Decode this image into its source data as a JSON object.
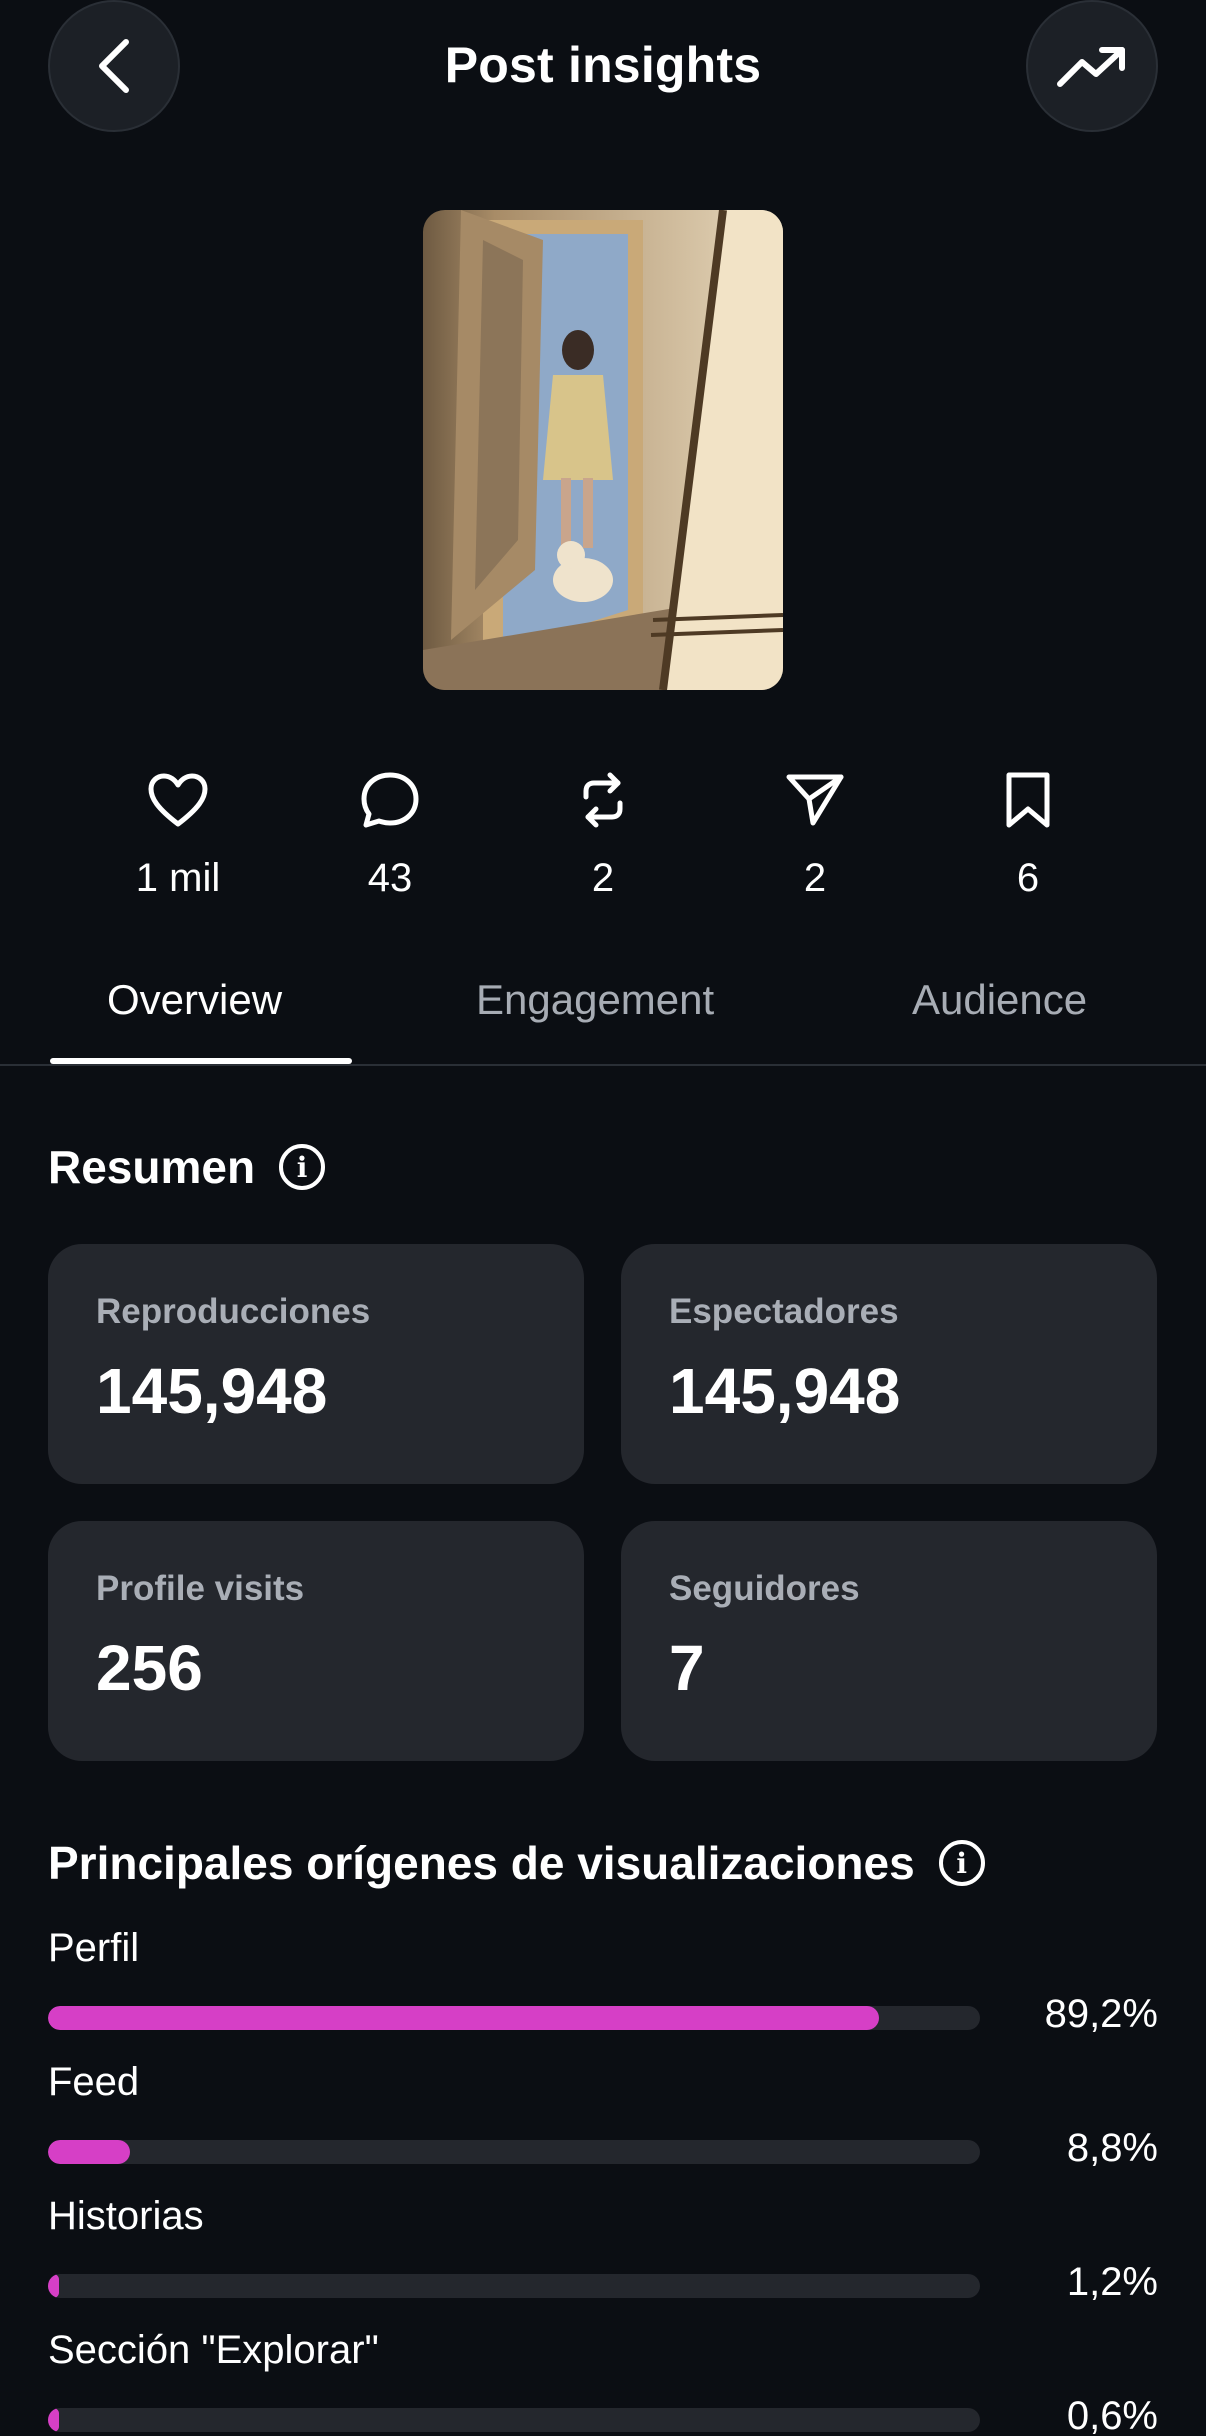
{
  "header": {
    "title": "Post insights",
    "back_icon": "chevron-left-icon",
    "trend_icon": "trending-up-icon"
  },
  "post_stats": [
    {
      "icon": "heart-icon",
      "count": "1 mil"
    },
    {
      "icon": "comment-icon",
      "count": "43"
    },
    {
      "icon": "repost-icon",
      "count": "2"
    },
    {
      "icon": "send-icon",
      "count": "2"
    },
    {
      "icon": "bookmark-icon",
      "count": "6"
    }
  ],
  "tabs": [
    {
      "label": "Overview",
      "active": true
    },
    {
      "label": "Engagement",
      "active": false
    },
    {
      "label": "Audience",
      "active": false
    }
  ],
  "summary": {
    "title": "Resumen",
    "cards": [
      {
        "label": "Reproducciones",
        "value": "145,948"
      },
      {
        "label": "Espectadores",
        "value": "145,948"
      },
      {
        "label": "Profile visits",
        "value": "256"
      },
      {
        "label": "Seguidores",
        "value": "7"
      }
    ]
  },
  "sources": {
    "title": "Principales orígenes de visualizaciones",
    "items": [
      {
        "name": "Perfil",
        "percent_text": "89,2%",
        "fraction": 0.892
      },
      {
        "name": "Feed",
        "percent_text": "8,8%",
        "fraction": 0.088
      },
      {
        "name": "Historias",
        "percent_text": "1,2%",
        "fraction": 0.012
      },
      {
        "name": "Sección \"Explorar\"",
        "percent_text": "0,6%",
        "fraction": 0.006
      }
    ]
  },
  "colors": {
    "background": "#0b0e13",
    "card": "#24272d",
    "accent_bar": "#d63fc6",
    "muted_text": "#a7acb4"
  }
}
